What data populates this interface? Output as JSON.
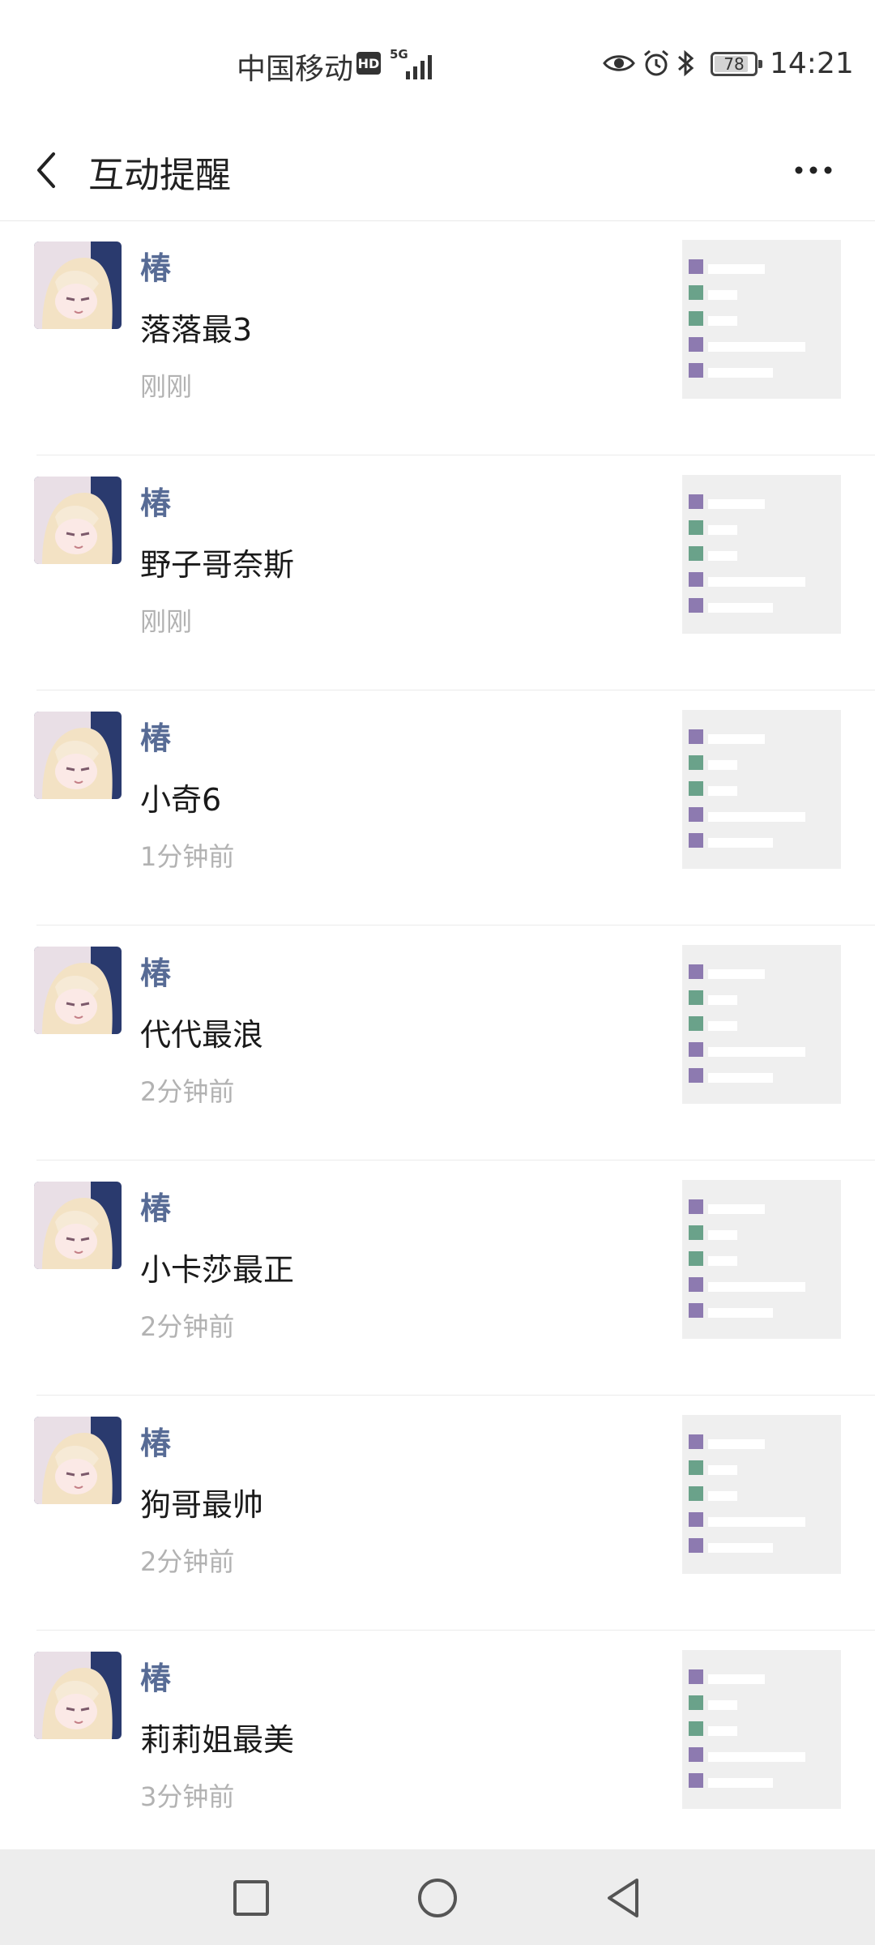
{
  "status_bar": {
    "carrier": "中国移动",
    "hd": "HD",
    "network": "5G",
    "battery": "78",
    "time": "14:21"
  },
  "header": {
    "title": "互动提醒"
  },
  "notifications": [
    {
      "name": "椿",
      "comment": "落落最3",
      "time": "刚刚"
    },
    {
      "name": "椿",
      "comment": "野子哥奈斯",
      "time": "刚刚"
    },
    {
      "name": "椿",
      "comment": "小奇6",
      "time": "1分钟前"
    },
    {
      "name": "椿",
      "comment": "代代最浪",
      "time": "2分钟前"
    },
    {
      "name": "椿",
      "comment": "小卡莎最正",
      "time": "2分钟前"
    },
    {
      "name": "椿",
      "comment": "狗哥最帅",
      "time": "2分钟前"
    },
    {
      "name": "椿",
      "comment": "莉莉姐最美",
      "time": "3分钟前"
    }
  ],
  "colors": {
    "name": "#576b95",
    "time": "#b2b2b2",
    "navbar": "#ededed"
  },
  "icons": {
    "back": "chevron-left-icon",
    "more": "more-dots-icon",
    "nav_recent": "square-icon",
    "nav_home": "circle-icon",
    "nav_back": "triangle-back-icon"
  }
}
